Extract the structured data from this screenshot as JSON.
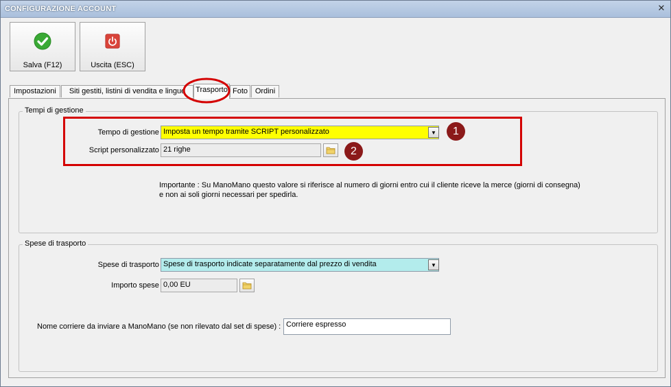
{
  "window": {
    "title": "CONFIGURAZIONE ACCOUNT",
    "close_glyph": "✕"
  },
  "toolbar": {
    "save": {
      "label": "Salva (F12)",
      "icon": "check-icon",
      "color": "#3aa935"
    },
    "exit": {
      "label": "Uscita (ESC)",
      "icon": "power-icon",
      "color": "#d9443a"
    }
  },
  "tabs": [
    {
      "label": "Impostazioni"
    },
    {
      "label": "Siti gestiti, listini di vendita e lingue"
    },
    {
      "label": "Trasporto",
      "active": true
    },
    {
      "label": "Foto"
    },
    {
      "label": "Ordini"
    }
  ],
  "tempi": {
    "title": "Tempi di gestione",
    "tempo_label": "Tempo di gestione :",
    "tempo_value": "Imposta un tempo tramite SCRIPT personalizzato",
    "tempo_bg": "#ffff00",
    "script_label": "Script personalizzato :",
    "script_value": "21 righe",
    "note_line1": "Importante : Su ManoMano questo valore si riferisce al numero di giorni entro cui il cliente riceve la merce (giorni di consegna)",
    "note_line2": "e non ai soli giorni necessari per spedirla."
  },
  "spese": {
    "title": "Spese di trasporto",
    "spese_label": "Spese di trasporto :",
    "spese_value": "Spese di trasporto indicate separatamente dal prezzo di vendita",
    "spese_bg": "#b3ecec",
    "importo_label": "Importo spese :",
    "importo_value": "0,00 EU",
    "corriere_label": "Nome corriere da inviare a ManoMano (se non rilevato dal set di spese) :",
    "corriere_value": "Corriere espresso"
  },
  "annotations": {
    "marker1": "1",
    "marker2": "2",
    "highlight_color": "#d40000"
  }
}
